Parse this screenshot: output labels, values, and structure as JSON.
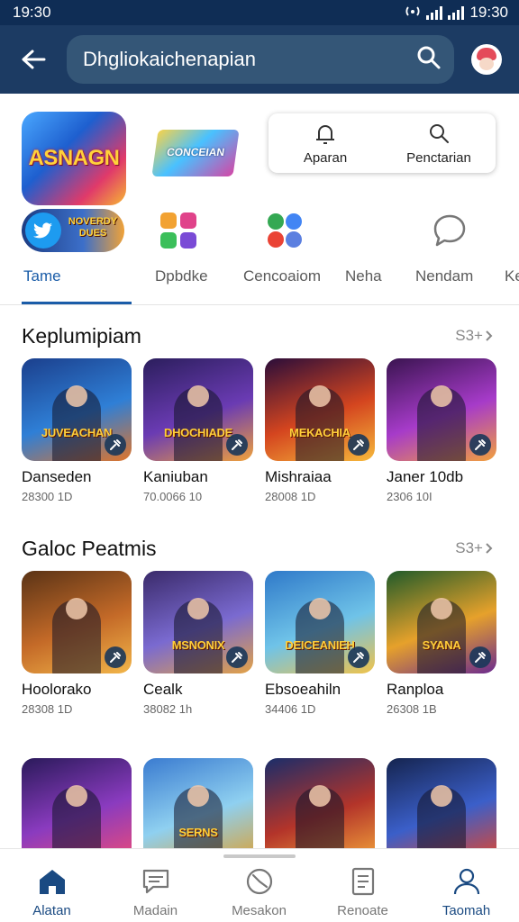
{
  "status_bar": {
    "time_left": "19:30",
    "time_right": "19:30"
  },
  "top_bar": {
    "search_text": "Dhgliokaichenapian"
  },
  "shortcuts": {
    "banner1_text": "ASNAGN",
    "banner2_text": "CONCEIAN",
    "tile_text": "NOVERDY DUES",
    "actions": [
      {
        "label": "Aparan",
        "icon": "bell-outline-icon"
      },
      {
        "label": "Penctarian",
        "icon": "search-icon"
      }
    ],
    "tabs": [
      {
        "label": "Tame",
        "icon": "twitter-bird-icon",
        "active": true
      },
      {
        "label": "Dpbdke",
        "icon": "colorful-squares-icon",
        "active": false
      },
      {
        "label": "Cencoaiom",
        "icon": "colorful-dots-icon",
        "active": false
      },
      {
        "label": "Neha",
        "icon": "none",
        "active": false
      },
      {
        "label": "Nendam",
        "icon": "chat-bubble-icon",
        "active": false
      },
      {
        "label": "Ke",
        "icon": "none",
        "active": false
      }
    ]
  },
  "sections": [
    {
      "title": "Keplumipiam",
      "more_label": "S3+",
      "items": [
        {
          "title": "Danseden",
          "meta": "28300 1D",
          "banner": "JUVEACHAN",
          "colors": [
            "#1b3f8c",
            "#2f7fd6",
            "#e0742a"
          ]
        },
        {
          "title": "Kaniuban",
          "meta": "70.0066 10",
          "banner": "DHOCHIADE",
          "colors": [
            "#2b1e5c",
            "#6a3bb3",
            "#f0a13b"
          ]
        },
        {
          "title": "Mishraiaa",
          "meta": "28008 1D",
          "banner": "MEKACHIA",
          "colors": [
            "#2a0d3a",
            "#d4451f",
            "#f6b93b"
          ]
        },
        {
          "title": "Janer 10db",
          "meta": "2306 10I",
          "banner": "",
          "colors": [
            "#3a1450",
            "#a63bc9",
            "#f2a03d"
          ]
        }
      ]
    },
    {
      "title": "Galoc Peatmis",
      "more_label": "S3+",
      "items": [
        {
          "title": "Hoolorako",
          "meta": "28308 1D",
          "banner": "",
          "colors": [
            "#5a3316",
            "#c46a28",
            "#f2b64a"
          ]
        },
        {
          "title": "Cealk",
          "meta": "38082 1h",
          "banner": "MSNONIX",
          "colors": [
            "#3a2a6a",
            "#7a6ad0",
            "#e3a246"
          ]
        },
        {
          "title": "Ebsoeahiln",
          "meta": "34406 1D",
          "banner": "DEICEANIEH",
          "colors": [
            "#2f79c9",
            "#6fc3e8",
            "#f0c34a"
          ]
        },
        {
          "title": "Ranploa",
          "meta": "26308 1B",
          "banner": "SYANA",
          "colors": [
            "#1f5a2a",
            "#e6a12b",
            "#6b2a8f"
          ]
        }
      ]
    },
    {
      "title": "",
      "more_label": "",
      "items": [
        {
          "title": "",
          "meta": "",
          "banner": "",
          "colors": [
            "#2a1a5a",
            "#8a3bbf",
            "#e94b7a"
          ]
        },
        {
          "title": "",
          "meta": "",
          "banner": "SERNS",
          "colors": [
            "#3a7bd0",
            "#8fd0f0",
            "#d9a23a"
          ]
        },
        {
          "title": "",
          "meta": "",
          "banner": "",
          "colors": [
            "#1a2d6a",
            "#b3342a",
            "#f2a23a"
          ]
        },
        {
          "title": "",
          "meta": "",
          "banner": "",
          "colors": [
            "#15244f",
            "#3b5fc9",
            "#e0462f"
          ]
        }
      ]
    }
  ],
  "bottom_nav": [
    {
      "label": "Alatan",
      "icon": "home-icon",
      "active": true
    },
    {
      "label": "Madain",
      "icon": "chat-icon",
      "active": false
    },
    {
      "label": "Mesakon",
      "icon": "clock-icon",
      "active": false
    },
    {
      "label": "Renoate",
      "icon": "document-icon",
      "active": false
    },
    {
      "label": "Taomah",
      "icon": "person-icon",
      "active": false
    }
  ]
}
